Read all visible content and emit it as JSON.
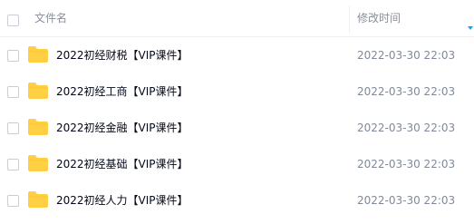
{
  "header": {
    "name_label": "文件名",
    "date_label": "修改时间"
  },
  "files": [
    {
      "name": "2022初经财税【VIP课件】",
      "modified": "2022-03-30 22:03"
    },
    {
      "name": "2022初经工商【VIP课件】",
      "modified": "2022-03-30 22:03"
    },
    {
      "name": "2022初经金融【VIP课件】",
      "modified": "2022-03-30 22:03"
    },
    {
      "name": "2022初经基础【VIP课件】",
      "modified": "2022-03-30 22:03"
    },
    {
      "name": "2022初经人力【VIP课件】",
      "modified": "2022-03-30 22:03"
    }
  ],
  "colors": {
    "folder": "#ffd043",
    "sort_accent": "#06a7ff"
  },
  "icons": {
    "folder": "folder-icon",
    "sort": "sort-descending-icon"
  }
}
